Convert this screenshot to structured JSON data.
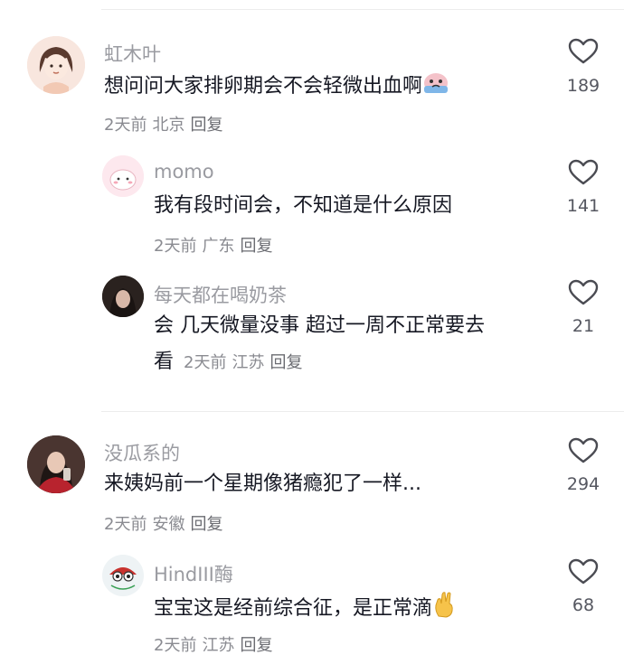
{
  "comments": [
    {
      "name": "虹木叶",
      "text": "想问问大家排卵期会不会轻微出血啊",
      "time": "2天前",
      "location": "北京",
      "reply": "回复",
      "likes": "189",
      "emoji_icon": "crying-face-icon"
    },
    {
      "name": "momo",
      "text": "我有段时间会，不知道是什么原因",
      "time": "2天前",
      "location": "广东",
      "reply": "回复",
      "likes": "141"
    },
    {
      "name": "每天都在喝奶茶",
      "text_line1": "会 几天微量没事  超过一周不正常要去",
      "text_line2": "看",
      "time": "2天前",
      "location": "江苏",
      "reply": "回复",
      "likes": "21"
    },
    {
      "name": "没瓜系的",
      "text": "来姨妈前一个星期像猪瘾犯了一样...",
      "time": "2天前",
      "location": "安徽",
      "reply": "回复",
      "likes": "294"
    },
    {
      "name": "HindIII酶",
      "text": "宝宝这是经前综合征，是正常滴",
      "time": "2天前",
      "location": "江苏",
      "reply": "回复",
      "likes": "68",
      "emoji_icon": "fingers-crossed-icon"
    }
  ],
  "colors": {
    "name": "#9a9ba1",
    "text": "#161823",
    "meta": "#8a8b91",
    "heart_stroke": "#4a4b52"
  }
}
